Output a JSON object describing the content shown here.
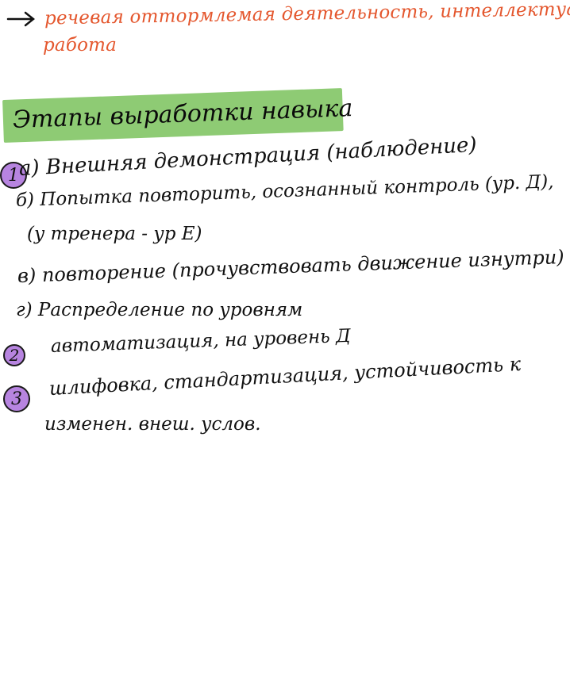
{
  "lines": {
    "orange_line1": "речевая оттормлемая деятельность, интеллектуальная",
    "orange_line2": "работа",
    "heading": "Этапы выработки навыка",
    "a": "а) Внешняя демонстрация (наблюдение)",
    "b1": "б) Попытка повторить, осознанный контроль (ур. Д),",
    "b2": "(у тренера - ур Е)",
    "v": "в) повторение (прочувствовать движение изнутри)",
    "g": "г) Распределение по уровням",
    "s2": "автоматизация, на уровень Д",
    "s3a": "шлифовка, стандартизация, устойчивость к",
    "s3b": "изменен. внеш. услов."
  },
  "markers": {
    "m1": "1",
    "m2": "2",
    "m3": "3"
  },
  "colors": {
    "orange_ink": "#e4572e",
    "black_ink": "#111111",
    "highlight_green": "#8ecb74",
    "marker_purple": "#b784e0"
  }
}
